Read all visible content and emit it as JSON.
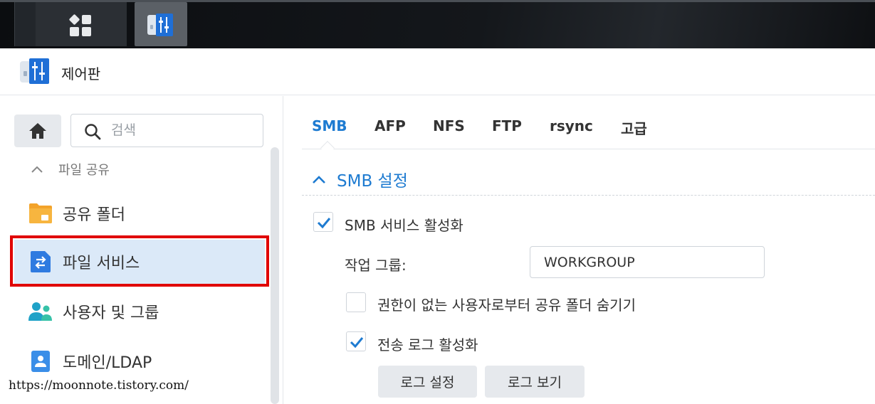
{
  "window": {
    "title": "제어판"
  },
  "taskbar": {
    "items": [
      {
        "icon": "main-menu-icon"
      },
      {
        "icon": "control-panel-icon"
      }
    ]
  },
  "sidebar": {
    "home_icon": "home-icon",
    "search": {
      "placeholder": "검색",
      "value": ""
    },
    "group": {
      "label": "파일 공유",
      "expanded": true
    },
    "items": [
      {
        "label": "공유 폴더",
        "icon": "shared-folder-icon",
        "active": false
      },
      {
        "label": "파일 서비스",
        "icon": "file-services-icon",
        "active": true
      },
      {
        "label": "사용자 및 그룹",
        "icon": "users-group-icon",
        "active": false
      },
      {
        "label": "도메인/LDAP",
        "icon": "domain-ldap-icon",
        "active": false
      }
    ]
  },
  "tabs": [
    {
      "label": "SMB",
      "active": true
    },
    {
      "label": "AFP",
      "active": false
    },
    {
      "label": "NFS",
      "active": false
    },
    {
      "label": "FTP",
      "active": false
    },
    {
      "label": "rsync",
      "active": false
    },
    {
      "label": "고급",
      "active": false
    }
  ],
  "smb_section": {
    "title": "SMB 설정",
    "enable_smb": {
      "label": "SMB 서비스 활성화",
      "checked": true
    },
    "workgroup": {
      "label": "작업 그룹:",
      "value": "WORKGROUP"
    },
    "hide_folders": {
      "label": "권한이 없는 사용자로부터 공유 폴더 숨기기",
      "checked": false
    },
    "transfer_log": {
      "label": "전송 로그 활성화",
      "checked": true
    },
    "buttons": {
      "log_settings": "로그 설정",
      "view_logs": "로그 보기"
    }
  },
  "watermark": "https://moonnote.tistory.com/",
  "colors": {
    "accent": "#1e7bd1",
    "highlight": "#e00000",
    "active_bg": "#dbe9f8"
  }
}
